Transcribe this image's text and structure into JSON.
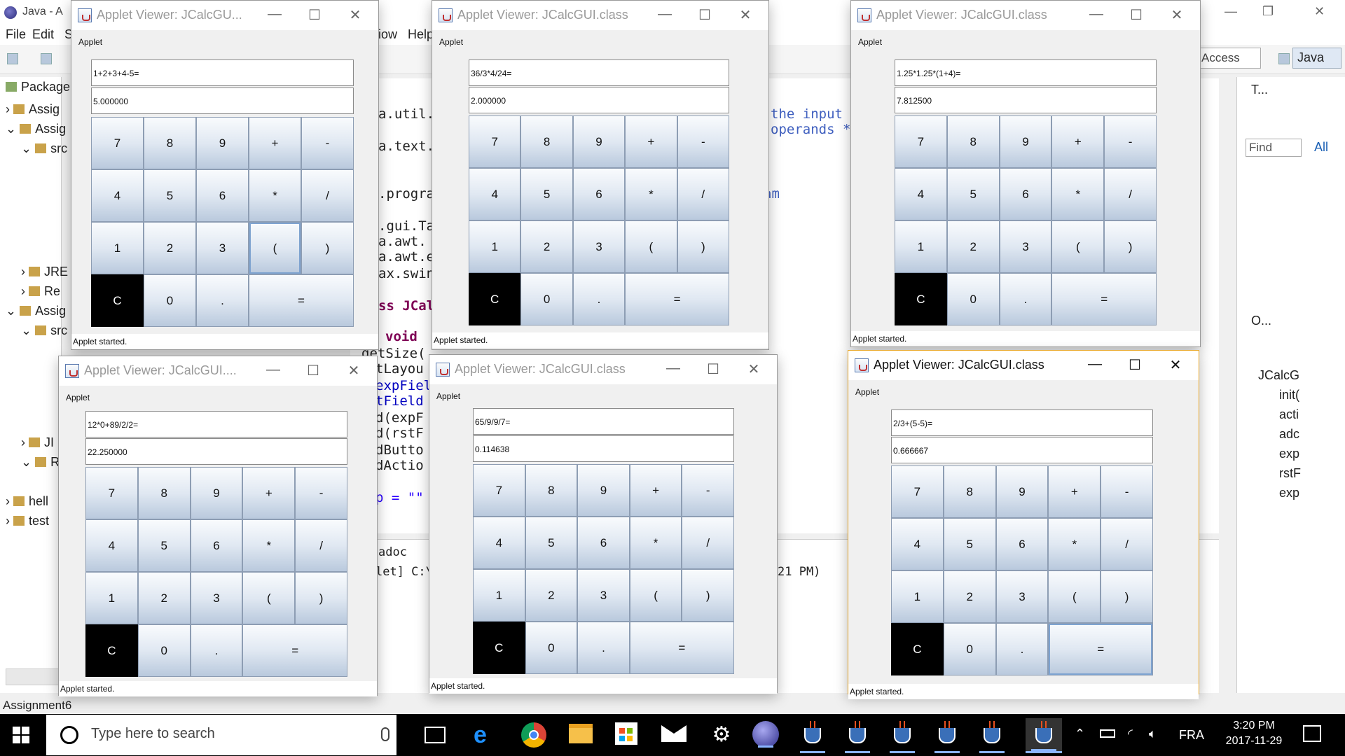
{
  "eclipse": {
    "title": "Java - A",
    "menus": [
      "File",
      "Edit",
      "S",
      "iow",
      "Help"
    ],
    "quick_access": "Access",
    "perspective": "Java",
    "package_explorer_title": "Package",
    "tree_items": [
      "Assig",
      "Assig",
      "src",
      "JRE",
      "Re",
      "Assig",
      "src",
      "JI",
      "R",
      "hell",
      "test"
    ],
    "code_lines": [
      {
        "text": "a.util.",
        "cls": ""
      },
      {
        "text": "a.text.",
        "cls": ""
      },
      {
        "text": ".progra",
        "cls": ""
      },
      {
        "text": ".gui.Ta",
        "cls": ""
      },
      {
        "text": "a.awt.",
        "cls": ""
      },
      {
        "text": "a.awt.e",
        "cls": ""
      },
      {
        "text": "ax.swin",
        "cls": ""
      },
      {
        "text": "ss JCal",
        "cls": "kw"
      },
      {
        "text": "void",
        "cls": "kw"
      },
      {
        "text": "getSize(",
        "cls": ""
      },
      {
        "text": "tLayou",
        "cls": ""
      },
      {
        "text": "expField",
        "cls": "fld"
      },
      {
        "text": "tField",
        "cls": "fld"
      },
      {
        "text": "d(expF",
        "cls": ""
      },
      {
        "text": "d(rstF",
        "cls": ""
      },
      {
        "text": "dButto",
        "cls": ""
      },
      {
        "text": "dActio",
        "cls": ""
      },
      {
        "text": "p = \"\"",
        "cls": "str"
      }
    ],
    "comment_lines": [
      "the input",
      "operands */",
      "am"
    ],
    "console_lines": [
      "adoc",
      "let] C:\\Pro",
      "21 PM)"
    ],
    "outline": {
      "title1": "T...",
      "find_placeholder": "Find",
      "all_label": "All",
      "title2": "O...",
      "class_name": "JCalcG",
      "members": [
        "init(",
        "acti",
        "adc",
        "exp",
        "rstF",
        "exp"
      ]
    },
    "status_left": "Assignment6"
  },
  "applets": [
    {
      "title": "Applet Viewer: JCalcGU...",
      "menu": "Applet",
      "expression": "1+2+3+4-5=",
      "result": "5.000000",
      "status": "Applet started.",
      "active": false,
      "focused_key": "("
    },
    {
      "title": "Applet Viewer: JCalcGUI.class",
      "menu": "Applet",
      "expression": "36/3*4/24=",
      "result": "2.000000",
      "status": "Applet started.",
      "active": false,
      "focused_key": ""
    },
    {
      "title": "Applet Viewer: JCalcGUI.class",
      "menu": "Applet",
      "expression": "1.25*1.25*(1+4)=",
      "result": "7.812500",
      "status": "Applet started.",
      "active": false,
      "focused_key": ""
    },
    {
      "title": "Applet Viewer: JCalcGUI....",
      "menu": "Applet",
      "expression": "12*0+89/2/2=",
      "result": "22.250000",
      "status": "Applet started.",
      "active": false,
      "focused_key": ""
    },
    {
      "title": "Applet Viewer: JCalcGUI.class",
      "menu": "Applet",
      "expression": "65/9/9/7=",
      "result": "0.114638",
      "status": "Applet started.",
      "active": false,
      "focused_key": ""
    },
    {
      "title": "Applet Viewer: JCalcGUI.class",
      "menu": "Applet",
      "expression": "2/3+(5-5)=",
      "result": "0.666667",
      "status": "Applet started.",
      "active": true,
      "focused_key": "="
    }
  ],
  "keypad": [
    [
      "7",
      "8",
      "9",
      "+",
      "-"
    ],
    [
      "4",
      "5",
      "6",
      "*",
      "/"
    ],
    [
      "1",
      "2",
      "3",
      "(",
      ")"
    ],
    [
      "C",
      "0",
      ".",
      "="
    ]
  ],
  "taskbar": {
    "search_placeholder": "Type here to search",
    "language": "FRA",
    "time": "3:20 PM",
    "date": "2017-11-29",
    "pinned": [
      "task-view-icon",
      "edge-icon",
      "chrome-icon",
      "file-explorer-icon",
      "store-icon",
      "mail-icon",
      "settings-icon",
      "eclipse-icon",
      "java-icon",
      "java-icon",
      "java-icon",
      "java-icon",
      "java-icon",
      "java-icon"
    ]
  }
}
